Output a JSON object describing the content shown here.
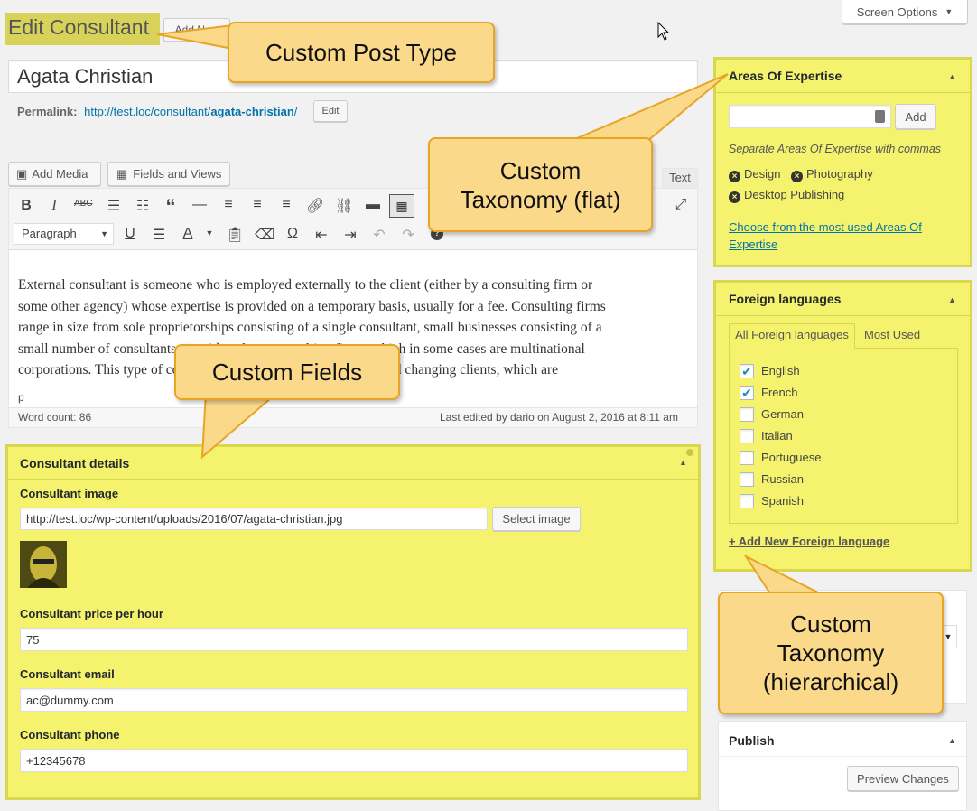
{
  "header": {
    "page_title": "Edit Consultant",
    "add_new_label": "Add New",
    "screen_options_label": "Screen Options"
  },
  "post": {
    "title": "Agata Christian",
    "permalink_label": "Permalink:",
    "permalink_base": "http://test.loc/consultant/",
    "permalink_slug": "agata-christian",
    "permalink_trail": "/",
    "edit_button_label": "Edit"
  },
  "editor": {
    "add_media_label": "Add Media",
    "fields_views_label": "Fields and Views",
    "text_tab_label": "Text",
    "format_select": "Paragraph",
    "body_lines": [
      "External consultant is someone who is employed externally to the client (either by a consulting firm or",
      "some other agency) whose expertise is provided on a temporary basis, usually for a fee. Consulting firms",
      "range in size from sole proprietorships consisting of a single consultant, small businesses consisting of a",
      "small number of consultants, to mid- to large consulting firms, which in some cases are multinational",
      "corporations. This type of consultant generally engages multiple and changing clients, which are"
    ],
    "path_label": "p",
    "word_count": "Word count: 86",
    "last_edited": "Last edited by dario on August 2, 2016 at 8:11 am"
  },
  "consultant_details": {
    "title": "Consultant details",
    "image_label": "Consultant image",
    "image_url": "http://test.loc/wp-content/uploads/2016/07/agata-christian.jpg",
    "select_image_label": "Select image",
    "price_label": "Consultant price per hour",
    "price_value": "75",
    "email_label": "Consultant email",
    "email_value": "ac@dummy.com",
    "phone_label": "Consultant phone",
    "phone_value": "+12345678"
  },
  "areas_of_expertise": {
    "title": "Areas Of Expertise",
    "add_label": "Add",
    "hint": "Separate Areas Of Expertise with commas",
    "tags": [
      "Design",
      "Photography",
      "Desktop Publishing"
    ],
    "choose_link": "Choose from the most used Areas Of Expertise"
  },
  "foreign_languages": {
    "title": "Foreign languages",
    "tab_all": "All Foreign languages",
    "tab_most_used": "Most Used",
    "items": [
      {
        "label": "English",
        "checked": true
      },
      {
        "label": "French",
        "checked": true
      },
      {
        "label": "German",
        "checked": false
      },
      {
        "label": "Italian",
        "checked": false
      },
      {
        "label": "Portuguese",
        "checked": false
      },
      {
        "label": "Russian",
        "checked": false
      },
      {
        "label": "Spanish",
        "checked": false
      }
    ],
    "add_new_link": "+ Add New Foreign language"
  },
  "publish": {
    "title": "Publish",
    "preview_label": "Preview Changes"
  },
  "callouts": {
    "post_type": "Custom Post Type",
    "tax_flat_line1": "Custom",
    "tax_flat_line2": "Taxonomy (flat)",
    "fields": "Custom Fields",
    "tax_hier_line1": "Custom",
    "tax_hier_line2": "Taxonomy",
    "tax_hier_line3": "(hierarchical)"
  },
  "colors": {
    "highlight": "#f5f36e",
    "callout_fill": "#fbd98a",
    "callout_border": "#e8a524",
    "link": "#0073aa"
  }
}
